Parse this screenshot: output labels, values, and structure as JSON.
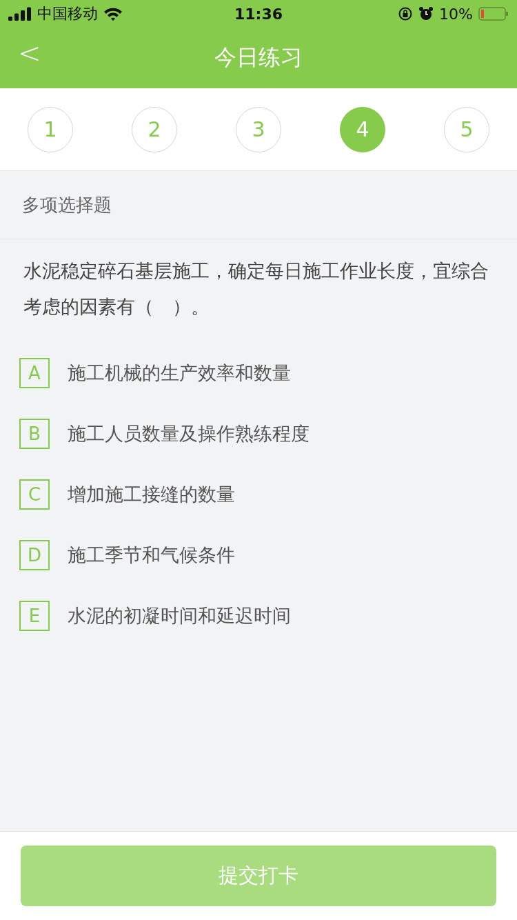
{
  "status_bar": {
    "carrier": "中国移动",
    "time": "11:36",
    "battery": "10%"
  },
  "nav": {
    "back": "<",
    "title": "今日练习"
  },
  "questions": [
    {
      "number": "1",
      "selected": false
    },
    {
      "number": "2",
      "selected": false
    },
    {
      "number": "3",
      "selected": false
    },
    {
      "number": "4",
      "selected": true
    },
    {
      "number": "5",
      "selected": false
    }
  ],
  "question_type": "多项选择题",
  "question": "水泥稳定碎石基层施工，确定每日施工作业长度，宜综合考虑的因素有（　）。",
  "options": [
    {
      "letter": "A",
      "text": "施工机械的生产效率和数量",
      "selected": false
    },
    {
      "letter": "B",
      "text": "施工人员数量及操作熟练程度",
      "selected": false
    },
    {
      "letter": "C",
      "text": "增加施工接缝的数量",
      "selected": false
    },
    {
      "letter": "D",
      "text": "施工季节和气候条件",
      "selected": false
    },
    {
      "letter": "E",
      "text": "水泥的初凝时间和延迟时间",
      "selected": false
    }
  ],
  "submit": {
    "label": "提交打卡",
    "disabled": true
  }
}
